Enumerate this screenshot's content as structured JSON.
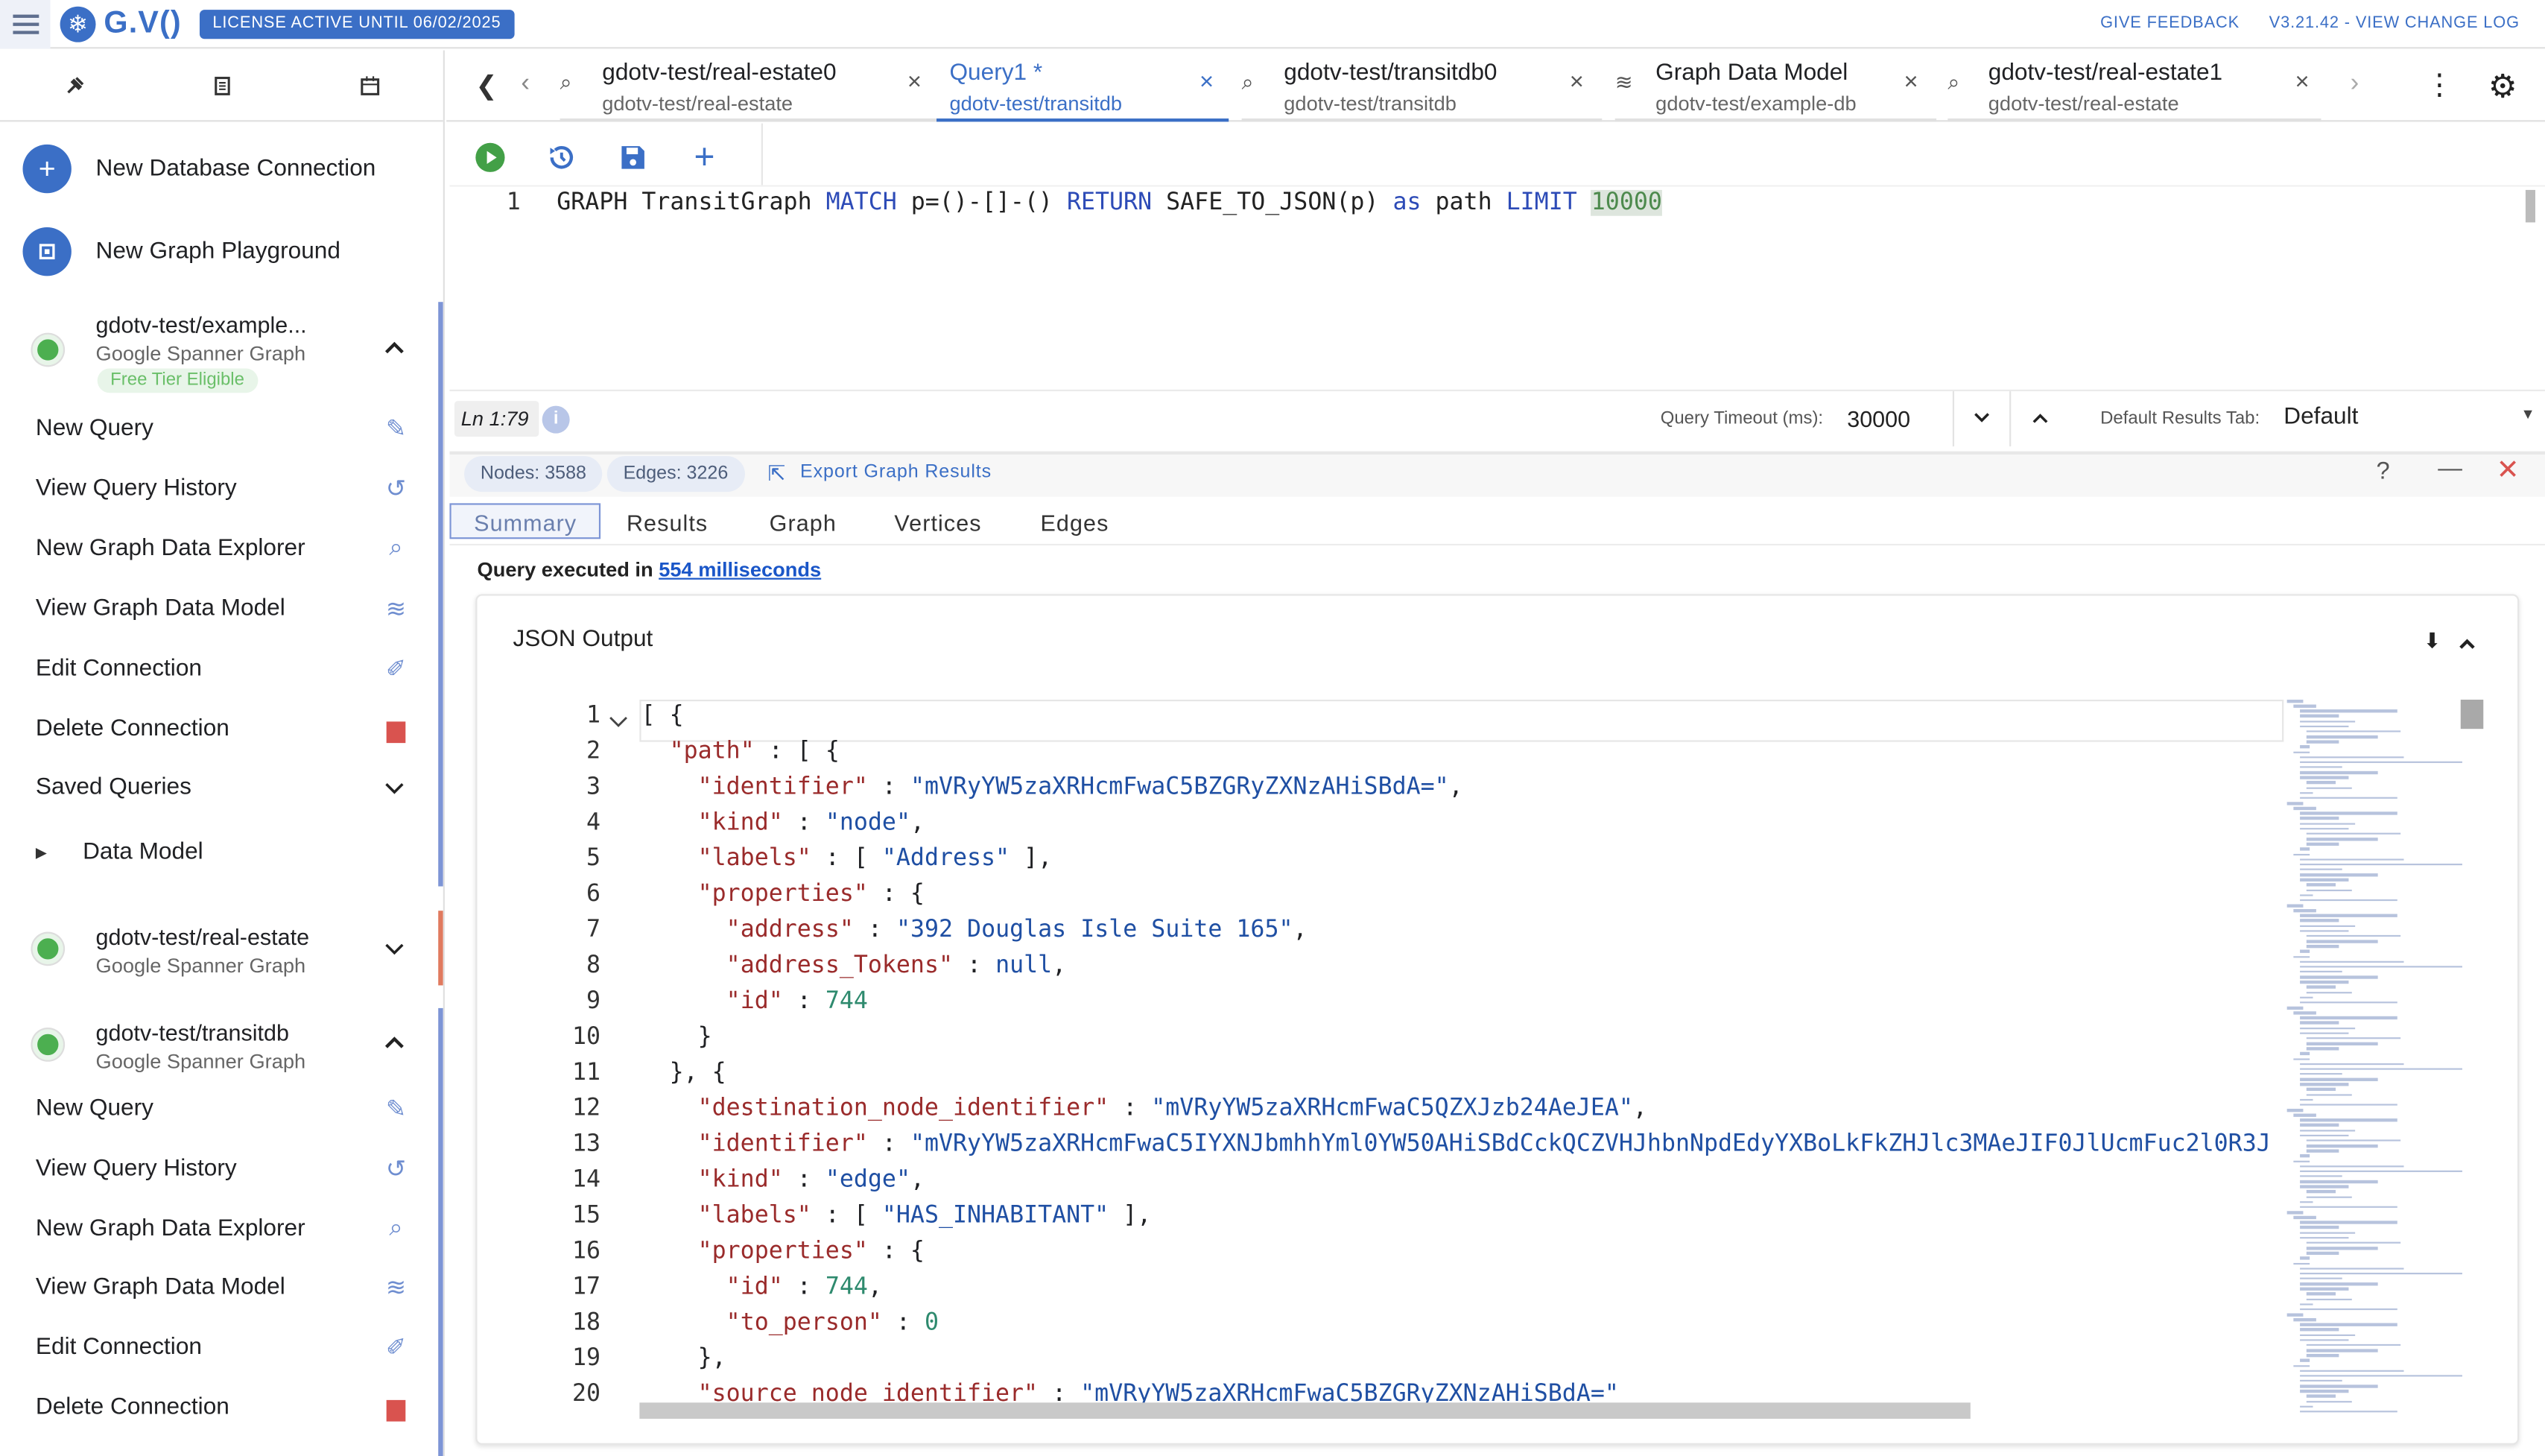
{
  "app": {
    "brand": "G.V()",
    "license": "LICENSE ACTIVE UNTIL 06/02/2025",
    "feedback": "GIVE FEEDBACK",
    "version": "V3.21.42 - VIEW CHANGE LOG"
  },
  "sidebar": {
    "new_db": "New Database Connection",
    "new_playground": "New Graph Playground",
    "conn1": {
      "name": "gdotv-test/example...",
      "type": "Google Spanner Graph",
      "badge": "Free Tier Eligible"
    },
    "conn1_items": [
      "New Query",
      "View Query History",
      "New Graph Data Explorer",
      "View Graph Data Model",
      "Edit Connection",
      "Delete Connection",
      "Saved Queries",
      "Data Model"
    ],
    "conn2": {
      "name": "gdotv-test/real-estate",
      "type": "Google Spanner Graph"
    },
    "conn3": {
      "name": "gdotv-test/transitdb",
      "type": "Google Spanner Graph"
    },
    "conn3_items": [
      "New Query",
      "View Query History",
      "New Graph Data Explorer",
      "View Graph Data Model",
      "Edit Connection",
      "Delete Connection"
    ]
  },
  "tabs": [
    {
      "title": "gdotv-test/real-estate0",
      "sub": "gdotv-test/real-estate"
    },
    {
      "title": "Query1 *",
      "sub": "gdotv-test/transitdb"
    },
    {
      "title": "gdotv-test/transitdb0",
      "sub": "gdotv-test/transitdb"
    },
    {
      "title": "Graph Data Model",
      "sub": "gdotv-test/example-db"
    },
    {
      "title": "gdotv-test/real-estate1",
      "sub": "gdotv-test/real-estate"
    }
  ],
  "editor": {
    "line_no": "1",
    "p1": "GRAPH TransitGraph ",
    "k1": "MATCH",
    "p2": " p=()-[]-() ",
    "k2": "RETURN",
    "p3": " SAFE_TO_JSON(p) ",
    "k3": "as",
    "p4": " path ",
    "k4": "LIMIT",
    "n1": "10000"
  },
  "status": {
    "cursor": "Ln 1:79",
    "timeout_label": "Query Timeout (ms):",
    "timeout_value": "30000",
    "default_tab_label": "Default Results Tab:",
    "default_tab_value": "Default"
  },
  "results": {
    "nodes": "Nodes: 3588",
    "edges": "Edges: 3226",
    "export": "Export Graph Results",
    "tabs": [
      "Summary",
      "Results",
      "Graph",
      "Vertices",
      "Edges"
    ],
    "exec_prefix": "Query executed in ",
    "exec_time": "554 milliseconds",
    "json_title": "JSON Output"
  },
  "json_lines": [
    {
      "n": "1",
      "parts": [
        [
          "p",
          "[ {"
        ]
      ]
    },
    {
      "n": "2",
      "parts": [
        [
          "p",
          "  "
        ],
        [
          "k",
          "\"path\""
        ],
        [
          "p",
          " : [ {"
        ]
      ]
    },
    {
      "n": "3",
      "parts": [
        [
          "p",
          "    "
        ],
        [
          "k",
          "\"identifier\""
        ],
        [
          "p",
          " : "
        ],
        [
          "v",
          "\"mVRyYW5zaXRHcmFwaC5BZGRyZXNzAHiSBdA=\""
        ],
        [
          "p",
          ","
        ]
      ]
    },
    {
      "n": "4",
      "parts": [
        [
          "p",
          "    "
        ],
        [
          "k",
          "\"kind\""
        ],
        [
          "p",
          " : "
        ],
        [
          "v",
          "\"node\""
        ],
        [
          "p",
          ","
        ]
      ]
    },
    {
      "n": "5",
      "parts": [
        [
          "p",
          "    "
        ],
        [
          "k",
          "\"labels\""
        ],
        [
          "p",
          " : [ "
        ],
        [
          "v",
          "\"Address\""
        ],
        [
          "p",
          " ],"
        ]
      ]
    },
    {
      "n": "6",
      "parts": [
        [
          "p",
          "    "
        ],
        [
          "k",
          "\"properties\""
        ],
        [
          "p",
          " : {"
        ]
      ]
    },
    {
      "n": "7",
      "parts": [
        [
          "p",
          "      "
        ],
        [
          "k",
          "\"address\""
        ],
        [
          "p",
          " : "
        ],
        [
          "v",
          "\"392 Douglas Isle Suite 165\""
        ],
        [
          "p",
          ","
        ]
      ]
    },
    {
      "n": "8",
      "parts": [
        [
          "p",
          "      "
        ],
        [
          "k",
          "\"address_Tokens\""
        ],
        [
          "p",
          " : "
        ],
        [
          "v",
          "null"
        ],
        [
          "p",
          ","
        ]
      ]
    },
    {
      "n": "9",
      "parts": [
        [
          "p",
          "      "
        ],
        [
          "k",
          "\"id\""
        ],
        [
          "p",
          " : "
        ],
        [
          "n",
          "744"
        ]
      ]
    },
    {
      "n": "10",
      "parts": [
        [
          "p",
          "    }"
        ]
      ]
    },
    {
      "n": "11",
      "parts": [
        [
          "p",
          "  }, {"
        ]
      ]
    },
    {
      "n": "12",
      "parts": [
        [
          "p",
          "    "
        ],
        [
          "k",
          "\"destination_node_identifier\""
        ],
        [
          "p",
          " : "
        ],
        [
          "v",
          "\"mVRyYW5zaXRHcmFwaC5QZXJzb24AeJEA\""
        ],
        [
          "p",
          ","
        ]
      ]
    },
    {
      "n": "13",
      "parts": [
        [
          "p",
          "    "
        ],
        [
          "k",
          "\"identifier\""
        ],
        [
          "p",
          " : "
        ],
        [
          "v",
          "\"mVRyYW5zaXRHcmFwaC5IYXNJbmhhYml0YW50AHiSBdCckQCZVHJhbnNpdEdyYXBoLkFkZHJlc3MAeJIF0JlUcmFuc2l0R3J"
        ]
      ]
    },
    {
      "n": "14",
      "parts": [
        [
          "p",
          "    "
        ],
        [
          "k",
          "\"kind\""
        ],
        [
          "p",
          " : "
        ],
        [
          "v",
          "\"edge\""
        ],
        [
          "p",
          ","
        ]
      ]
    },
    {
      "n": "15",
      "parts": [
        [
          "p",
          "    "
        ],
        [
          "k",
          "\"labels\""
        ],
        [
          "p",
          " : [ "
        ],
        [
          "v",
          "\"HAS_INHABITANT\""
        ],
        [
          "p",
          " ],"
        ]
      ]
    },
    {
      "n": "16",
      "parts": [
        [
          "p",
          "    "
        ],
        [
          "k",
          "\"properties\""
        ],
        [
          "p",
          " : {"
        ]
      ]
    },
    {
      "n": "17",
      "parts": [
        [
          "p",
          "      "
        ],
        [
          "k",
          "\"id\""
        ],
        [
          "p",
          " : "
        ],
        [
          "n",
          "744"
        ],
        [
          "p",
          ","
        ]
      ]
    },
    {
      "n": "18",
      "parts": [
        [
          "p",
          "      "
        ],
        [
          "k",
          "\"to_person\""
        ],
        [
          "p",
          " : "
        ],
        [
          "n",
          "0"
        ]
      ]
    },
    {
      "n": "19",
      "parts": [
        [
          "p",
          "    },"
        ]
      ]
    },
    {
      "n": "20",
      "parts": [
        [
          "p",
          "    "
        ],
        [
          "k",
          "\"source_node_identifier\""
        ],
        [
          "p",
          " : "
        ],
        [
          "v",
          "\"mVRyYW5zaXRHcmFwaC5BZGRyZXNzAHiSBdA=\""
        ]
      ]
    }
  ],
  "colors": {
    "accent": "#3b6fc6",
    "node_green": "#4caf50",
    "delete_red": "#d9534f"
  },
  "icons": [
    "menu-icon",
    "snowflake-logo-icon",
    "pin-icon",
    "copy-icon",
    "calendar-icon",
    "plus-icon",
    "playground-icon",
    "chevron-up-icon",
    "chevron-down-icon",
    "edit-query-icon",
    "history-icon",
    "data-explorer-icon",
    "database-icon",
    "edit-connection-icon",
    "trash-icon",
    "play-icon",
    "save-icon",
    "settings-icon",
    "more-vert-icon",
    "info-icon",
    "export-icon",
    "help-icon",
    "minimize-icon",
    "close-icon",
    "download-icon"
  ]
}
